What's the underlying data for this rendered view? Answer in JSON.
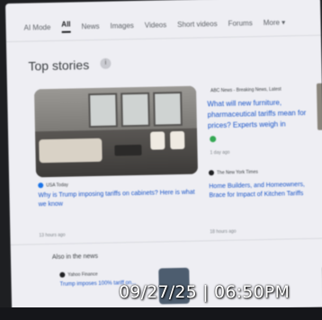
{
  "tabs": [
    "AI Mode",
    "All",
    "News",
    "Images",
    "Videos",
    "Short videos",
    "Forums",
    "More ▾"
  ],
  "section_title": "Top stories",
  "stories": [
    {
      "source": "USA Today",
      "headline": "Why is Trump imposing tariffs on cabinets? Here is what we know",
      "time": "13 hours ago"
    },
    {
      "source": "ABC News - Breaking News, Latest",
      "headline": "What will new furniture, pharmaceutical tariffs mean for prices? Experts weigh in",
      "time": "1 day ago"
    },
    {
      "source": "The New York Times",
      "headline": "Home Builders, and Homeowners, Brace for Impact of Kitchen Tariffs",
      "time": "18 hours ago"
    }
  ],
  "also_in_news": "Also in the news",
  "bottom_items": [
    {
      "source": "Yahoo Finance",
      "headline": "Trump imposes 100% tariff on..."
    }
  ],
  "timestamp": {
    "date": "09/27/25",
    "separator": "|",
    "time": "06:50PM"
  }
}
